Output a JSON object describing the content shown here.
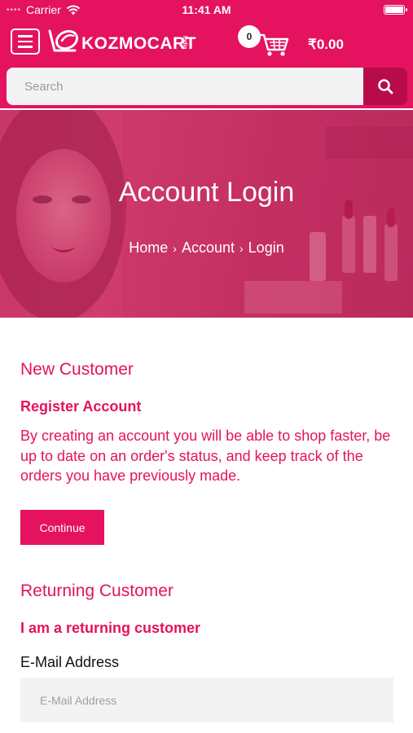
{
  "status_bar": {
    "carrier": "Carrier",
    "time": "11:41 AM"
  },
  "header": {
    "brand": "KOZMOCART",
    "brand_tag": "India",
    "cart_count": "0",
    "cart_total": "₹0.00"
  },
  "search": {
    "placeholder": "Search"
  },
  "hero": {
    "title": "Account Login",
    "breadcrumb": [
      "Home",
      "Account",
      "Login"
    ],
    "breadcrumb_sep": "›"
  },
  "new_customer": {
    "heading": "New Customer",
    "subheading": "Register Account",
    "description": "By creating an account you will be able to shop faster, be up to date on an order's status, and keep track of the orders you have previously made.",
    "button": "Continue"
  },
  "returning_customer": {
    "heading": "Returning Customer",
    "subheading": "I am a returning customer",
    "email_label": "E-Mail Address",
    "email_placeholder": "E-Mail Address"
  },
  "colors": {
    "accent": "#e4125f",
    "accent_dark": "#b80c4a",
    "field_bg": "#f3f3f3"
  },
  "icons": [
    "wifi-icon",
    "battery-icon",
    "menu-icon",
    "logo-icon",
    "cart-icon",
    "search-icon"
  ]
}
